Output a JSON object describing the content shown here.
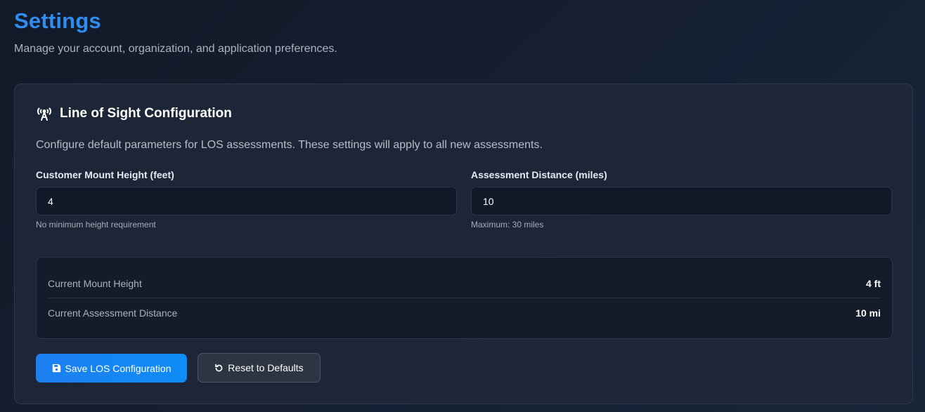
{
  "header": {
    "title": "Settings",
    "subtitle": "Manage your account, organization, and application preferences."
  },
  "los_card": {
    "icon": "broadcast-tower-icon",
    "title": "Line of Sight Configuration",
    "description": "Configure default parameters for LOS assessments. These settings will apply to all new assessments.",
    "mount_height": {
      "label": "Customer Mount Height (feet)",
      "value": "4",
      "help": "No minimum height requirement"
    },
    "assessment_distance": {
      "label": "Assessment Distance (miles)",
      "value": "10",
      "help": "Maximum: 30 miles"
    },
    "summary": {
      "rows": [
        {
          "label": "Current Mount Height",
          "value": "4 ft"
        },
        {
          "label": "Current Assessment Distance",
          "value": "10 mi"
        }
      ]
    },
    "buttons": {
      "save": {
        "icon": "save-icon",
        "label": "Save LOS Configuration"
      },
      "reset": {
        "icon": "undo-icon",
        "label": "Reset to Defaults"
      }
    }
  },
  "colors": {
    "title_accent": "#2f8cf0",
    "primary_button": "#1d7ff0",
    "card_background": "#1e2838",
    "input_background": "#111928"
  }
}
